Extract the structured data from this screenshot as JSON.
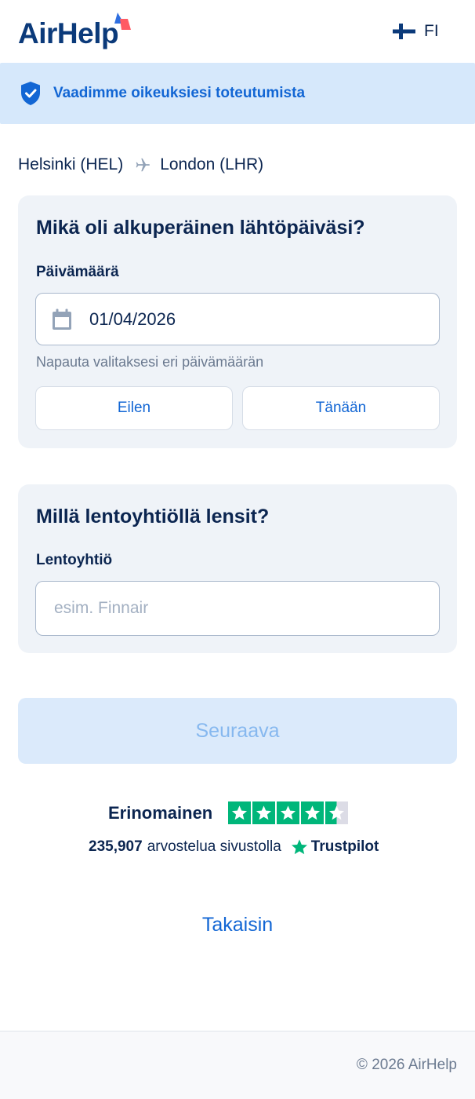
{
  "header": {
    "logo_text": "AirHelp",
    "language_code": "FI"
  },
  "banner": {
    "text": "Vaadimme oikeuksiesi toteutumista"
  },
  "route": {
    "origin": "Helsinki (HEL)",
    "destination": "London (LHR)"
  },
  "date_card": {
    "title": "Mikä oli alkuperäinen lähtöpäiväsi?",
    "label": "Päivämäärä",
    "value": "01/04/2026",
    "hint": "Napauta valitaksesi eri päivämäärän",
    "yesterday_label": "Eilen",
    "today_label": "Tänään"
  },
  "airline_card": {
    "title": "Millä lentoyhtiöllä lensit?",
    "label": "Lentoyhtiö",
    "value": "",
    "placeholder": "esim. Finnair"
  },
  "next_button": {
    "label": "Seuraava"
  },
  "rating": {
    "word": "Erinomainen",
    "stars": 4.5,
    "review_count": "235,907",
    "reviews_text": "arvostelua sivustolla",
    "source": "Trustpilot"
  },
  "back_link": {
    "label": "Takaisin"
  },
  "footer": {
    "copyright": "© 2026 AirHelp"
  },
  "colors": {
    "brand_dark": "#0b3a7a",
    "accent_blue": "#1266d4",
    "banner_bg": "#d6e8fb",
    "card_bg": "#eff3f8",
    "disabled_button_bg": "#dbeafb",
    "disabled_button_text": "#86b8ef",
    "trustpilot_green": "#00b67a"
  },
  "icons": {
    "logo_mark": "airhelp-logo-mark-icon",
    "flag": "finland-flag-icon",
    "banner": "shield-check-icon",
    "route": "airplane-icon",
    "date": "calendar-icon",
    "rating": "trustpilot-star-icon"
  }
}
